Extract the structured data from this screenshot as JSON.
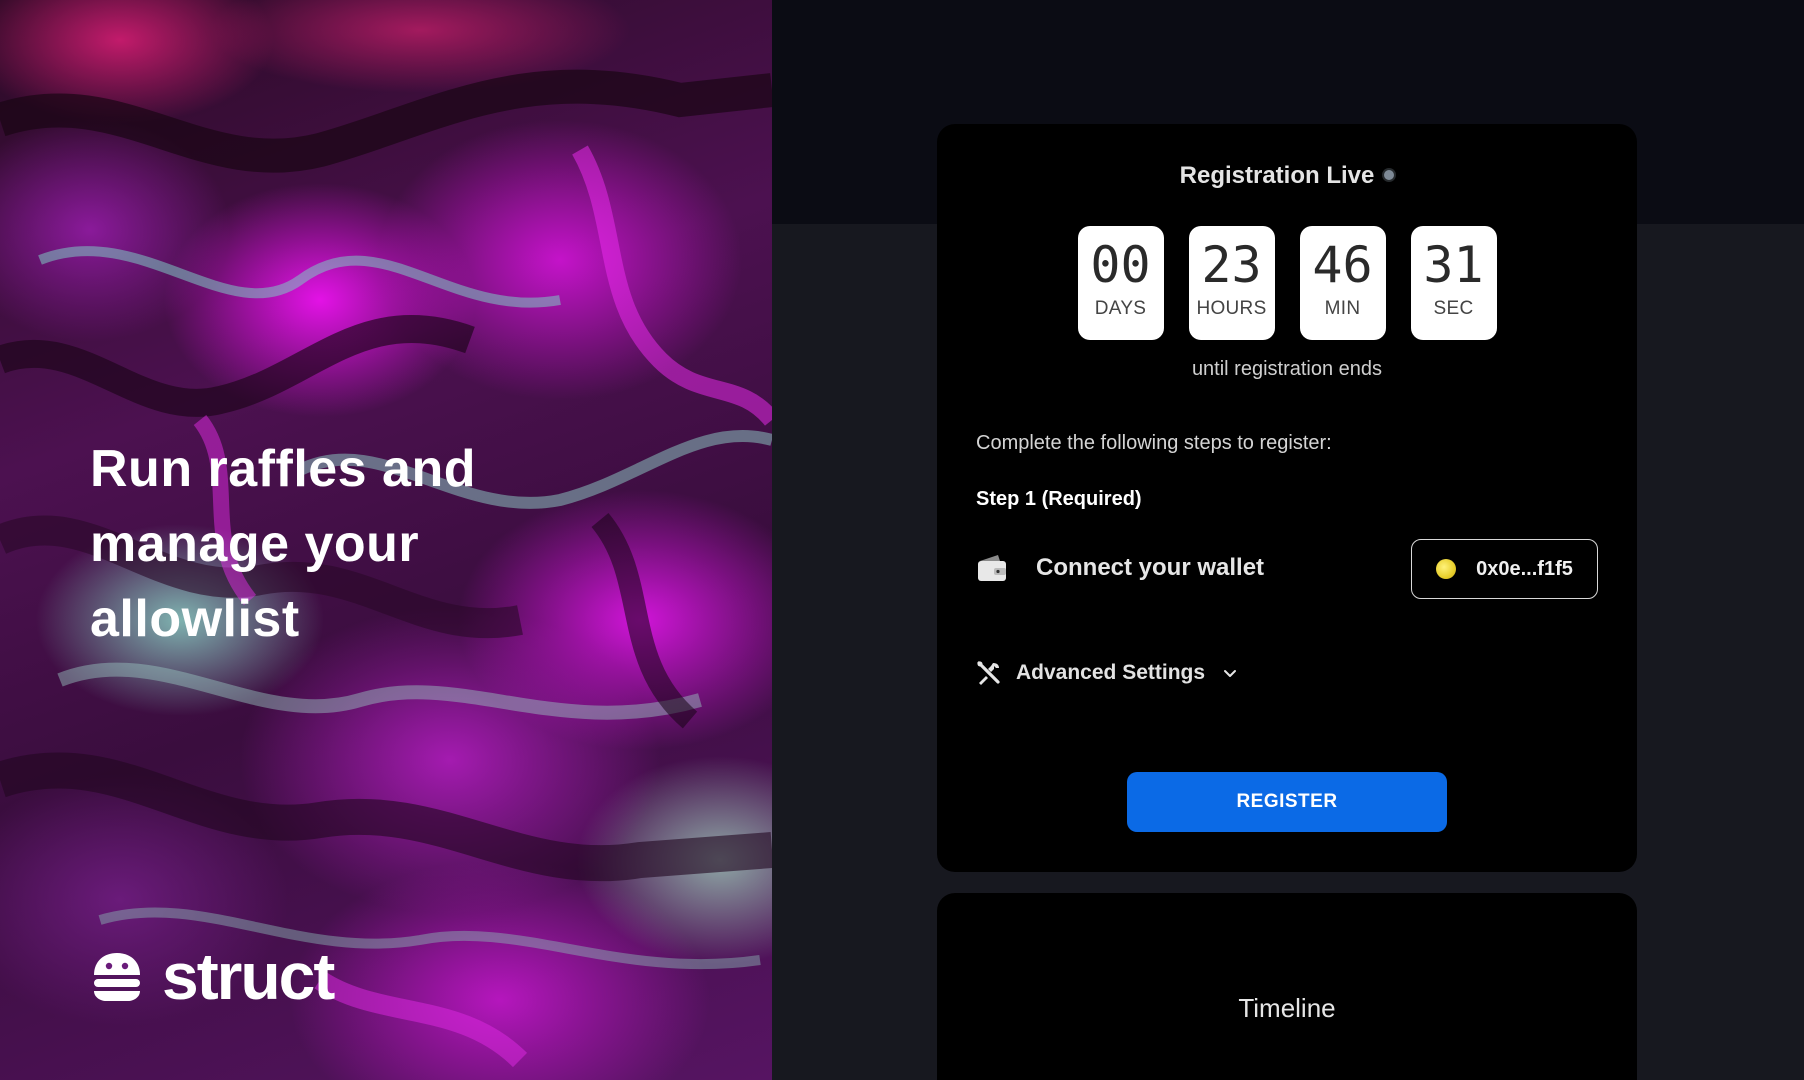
{
  "hero": {
    "headline": "Run raffles and manage your allowlist",
    "brand": "struct"
  },
  "registration": {
    "title": "Registration Live",
    "countdown": [
      {
        "value": "00",
        "unit": "DAYS"
      },
      {
        "value": "23",
        "unit": "HOURS"
      },
      {
        "value": "46",
        "unit": "MIN"
      },
      {
        "value": "31",
        "unit": "SEC"
      }
    ],
    "until_text": "until registration ends",
    "instructions": "Complete the following steps to register:",
    "step1_label": "Step 1 (Required)",
    "step1_text": "Connect your wallet",
    "wallet_address": "0x0e...f1f5",
    "advanced_settings": "Advanced Settings",
    "register_button": "REGISTER"
  },
  "timeline": {
    "title": "Timeline"
  },
  "colors": {
    "accent_blue": "#0b6ae6",
    "card_bg": "#000000",
    "page_bg": "#17181f",
    "hero_magenta": "#e312e6"
  },
  "icons": {
    "wallet": "wallet-icon",
    "tools": "tools-icon",
    "chevron": "chevron-down-icon",
    "avatar": "wallet-avatar",
    "logo": "struct-logo-icon"
  }
}
